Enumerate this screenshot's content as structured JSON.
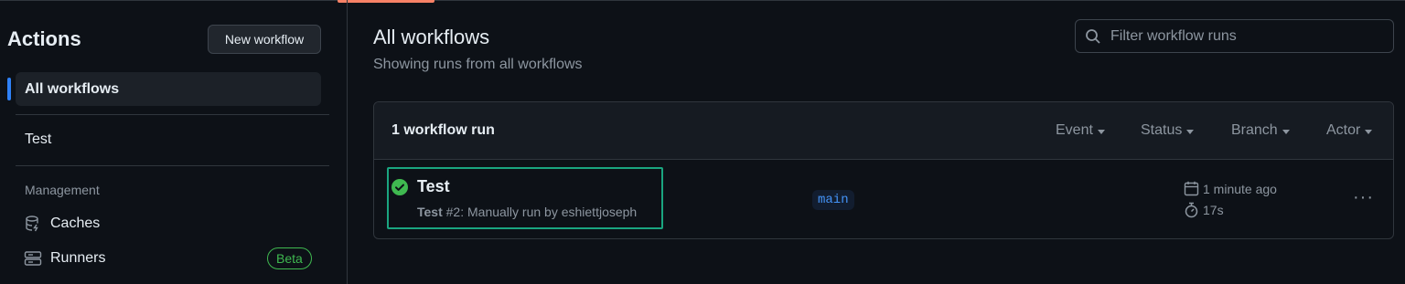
{
  "sidebar": {
    "title": "Actions",
    "new_workflow_label": "New workflow",
    "items": [
      {
        "label": "All workflows",
        "active": true
      },
      {
        "label": "Test",
        "active": false
      }
    ],
    "management": {
      "label": "Management",
      "items": [
        {
          "label": "Caches",
          "icon": "database-icon"
        },
        {
          "label": "Runners",
          "icon": "server-icon",
          "badge": "Beta"
        }
      ]
    }
  },
  "main": {
    "title": "All workflows",
    "subtitle": "Showing runs from all workflows",
    "filter_placeholder": "Filter workflow runs",
    "runs": {
      "count_label": "1 workflow run",
      "filters": [
        "Event",
        "Status",
        "Branch",
        "Actor"
      ],
      "items": [
        {
          "title": "Test",
          "workflow": "Test",
          "run_number": "#2",
          "trigger_text": ": Manually run by eshiettjoseph",
          "branch": "main",
          "time_ago": "1 minute ago",
          "duration": "17s",
          "status": "success"
        }
      ]
    }
  },
  "colors": {
    "accent": "#2f81f7",
    "success": "#3fb950",
    "highlight": "#1aa580",
    "tab_accent": "#f78166"
  }
}
